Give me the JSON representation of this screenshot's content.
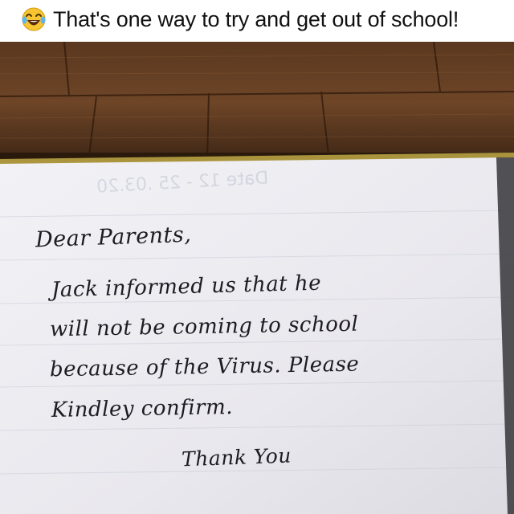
{
  "post": {
    "emoji_icon": "face-with-tears-of-joy-icon",
    "caption": "That's one way to try and get out of school!"
  },
  "note": {
    "ghost_text": "Date 12 - 25 .03.20",
    "lines": [
      "Dear Parents,",
      "Jack informed us that he",
      "will not be coming to school",
      "because of the Virus. Please",
      "Kindley confirm.",
      "Thank You"
    ]
  },
  "colors": {
    "wood_dark": "#3a2414",
    "wood_mid": "#6b4326",
    "paper": "#ecebf0",
    "ink": "#1c1c22"
  }
}
